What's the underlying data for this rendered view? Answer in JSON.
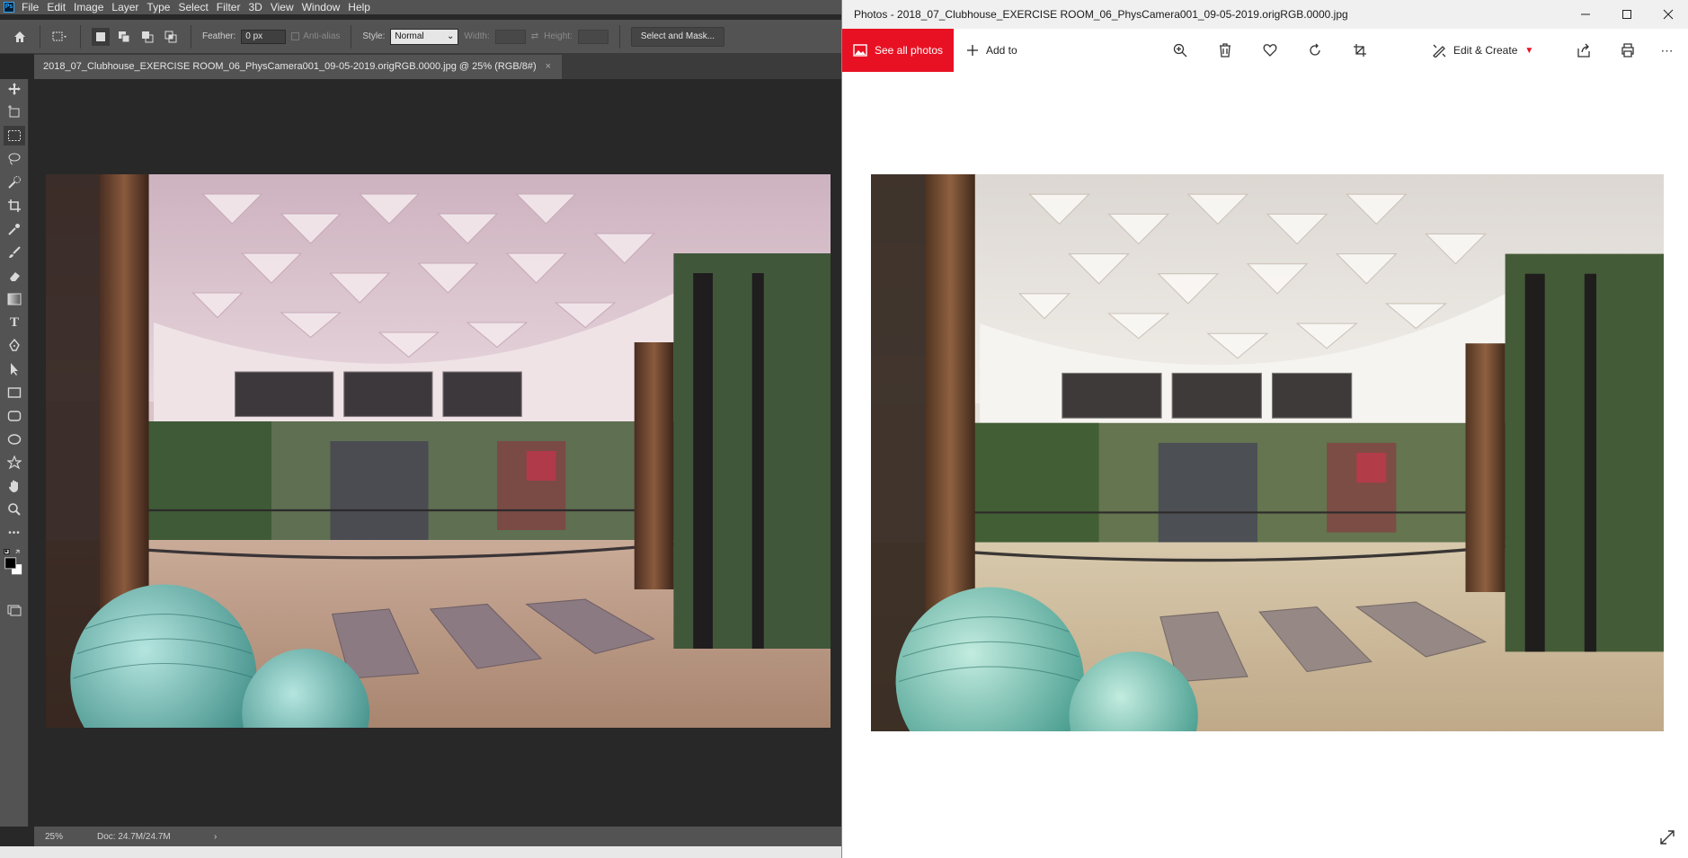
{
  "photoshop": {
    "logo": "Ps",
    "menus": [
      "File",
      "Edit",
      "Image",
      "Layer",
      "Type",
      "Select",
      "Filter",
      "3D",
      "View",
      "Window",
      "Help"
    ],
    "options": {
      "feather_label": "Feather:",
      "feather_value": "0 px",
      "anti_alias_label": "Anti-alias",
      "style_label": "Style:",
      "style_value": "Normal",
      "width_label": "Width:",
      "height_label": "Height:",
      "select_and_mask": "Select and Mask..."
    },
    "document_tab": "2018_07_Clubhouse_EXERCISE ROOM_06_PhysCamera001_09-05-2019.origRGB.0000.jpg @ 25% (RGB/8#)",
    "document_tab_close": "×",
    "status": {
      "zoom": "25%",
      "doc_size": "Doc: 24.7M/24.7M",
      "arrow": "›"
    },
    "tools": [
      "move-tool",
      "artboard-tool",
      "rectangular-marquee-tool",
      "lasso-tool",
      "quick-selection-tool",
      "crop-tool",
      "eyedropper-tool",
      "brush-tool",
      "eraser-tool",
      "gradient-tool",
      "type-tool",
      "pen-tool",
      "path-selection-tool",
      "rectangle-tool",
      "rounded-rectangle-tool",
      "ellipse-tool",
      "custom-shape-tool",
      "hand-tool",
      "zoom-tool",
      "more-tools",
      "color-swatches",
      "screen-mode"
    ],
    "tool_glyphs": {
      "type": "T",
      "more": "•••"
    }
  },
  "photos": {
    "title": "Photos - 2018_07_Clubhouse_EXERCISE ROOM_06_PhysCamera001_09-05-2019.origRGB.0000.jpg",
    "see_all_photos": "See all photos",
    "add_to": "Add to",
    "edit_create": "Edit & Create",
    "accent_color": "#e81123",
    "commands": [
      "zoom-icon",
      "delete-icon",
      "favorite-icon",
      "rotate-icon",
      "crop-icon",
      "share-icon",
      "print-icon",
      "more-icon"
    ]
  }
}
